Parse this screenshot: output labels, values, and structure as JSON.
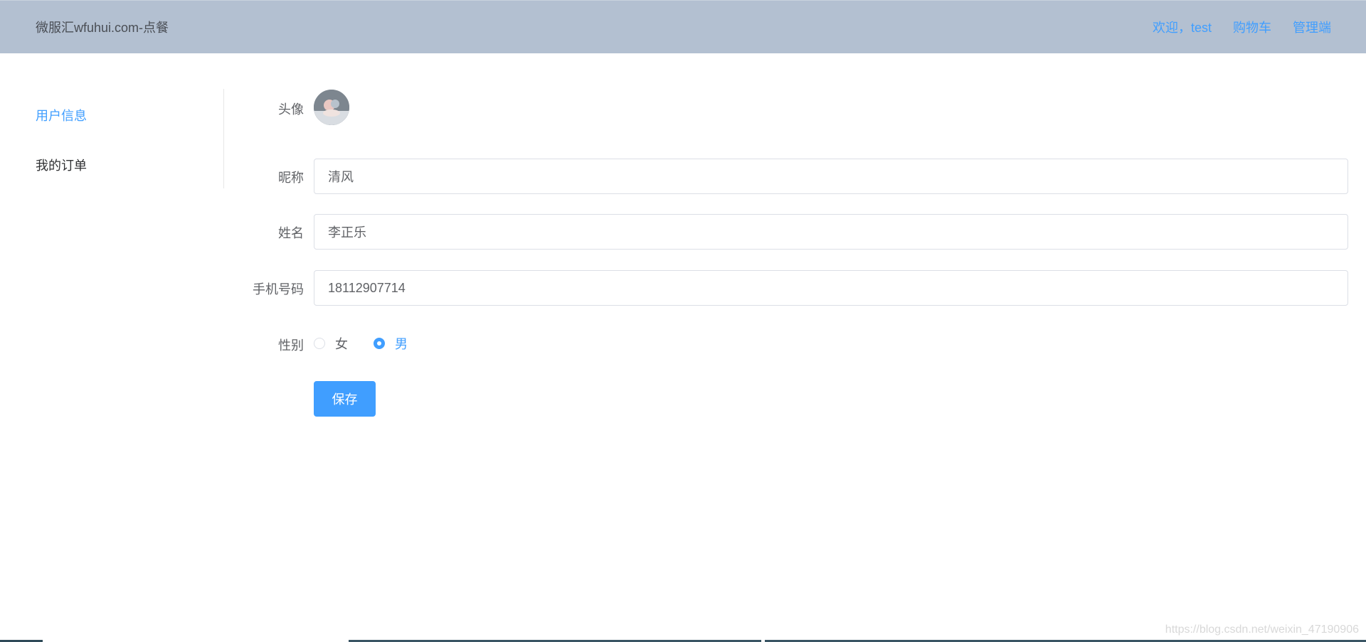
{
  "header": {
    "brand": "微服汇wfuhui.com-点餐",
    "nav": {
      "welcome": "欢迎，test",
      "cart": "购物车",
      "admin": "管理端"
    }
  },
  "sidebar": {
    "items": [
      {
        "label": "用户信息",
        "active": true
      },
      {
        "label": "我的订单",
        "active": false
      }
    ]
  },
  "form": {
    "avatar_label": "头像",
    "nickname_label": "昵称",
    "nickname_value": "清风",
    "name_label": "姓名",
    "name_value": "李正乐",
    "phone_label": "手机号码",
    "phone_value": "18112907714",
    "gender_label": "性别",
    "gender_options": [
      {
        "label": "女",
        "checked": false
      },
      {
        "label": "男",
        "checked": true
      }
    ],
    "save_label": "保存"
  },
  "watermark": "https://blog.csdn.net/weixin_47190906",
  "colors": {
    "header_bg": "#b3c0d1",
    "accent": "#409eff"
  }
}
